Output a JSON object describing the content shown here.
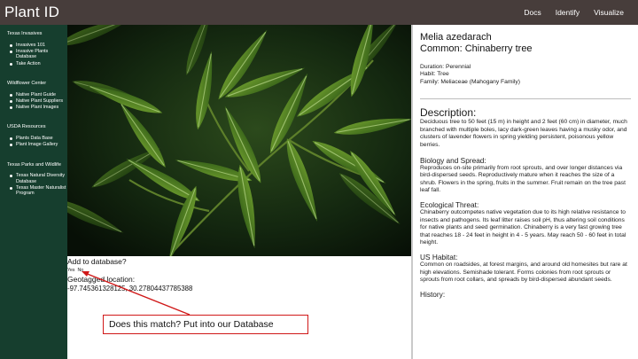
{
  "brand": "Plant ID",
  "nav": [
    "Docs",
    "Identify",
    "Visualize"
  ],
  "sidebar": {
    "sections": [
      {
        "heading": "Texas Invasives",
        "items": [
          "Invasives 101",
          "Invasive Plants Database",
          "Take Action"
        ]
      },
      {
        "heading": "Wildflower Center",
        "items": [
          "Native Plant Guide",
          "Native Plant Suppliers",
          "Native Plant Images"
        ]
      },
      {
        "heading": "USDA Resources",
        "items": [
          "Plants Data Base",
          "Plant Image Gallery"
        ]
      },
      {
        "heading": "Texas Parks and Wildlife",
        "items": [
          "Texas Natural Diversity Database",
          "Texas Master Naturalist Program"
        ]
      }
    ]
  },
  "add": {
    "title": "Add to database?",
    "yes": "Yes",
    "no": "No",
    "geo_title": "Geotagged location:",
    "geo_value": "-97.745361328125, 30.27804437785388"
  },
  "callout": "Does this match? Put into our Database",
  "plant": {
    "scientific": "Melia azedarach",
    "common": "Common: Chinaberry tree",
    "duration": "Duration: Perennial",
    "habit": "Habit: Tree",
    "family": "Family: Meliaceae (Mahogany Family)",
    "description_heading": "Description:",
    "description": "Deciduous tree to 50 feet (15 m) in height and 2 feet (60 cm) in diameter, much branched with multiple boles, lacy dark-green leaves having a musky odor, and clusters of lavender flowers in spring yielding persistent, poisonous yellow berries.",
    "biology_heading": "Biology and Spread:",
    "biology": "Reproduces on-site primarily from root sprouts, and over longer distances via bird-dispersed seeds. Reproductively mature when it reaches the size of a shrub. Flowers in the spring, fruits in the summer. Fruit remain on the tree past leaf fall.",
    "threat_heading": "Ecological Threat:",
    "threat": "Chinaberry outcompetes native vegetation due to its high relative resistance to insects and pathogens. Its leaf litter raises soil pH, thus altering soil conditions for native plants and seed germination. Chinaberry is a very fast growing tree that reaches 18 - 24 feet in height in 4 - 5 years. May reach 50 - 60 feet in total height.",
    "habitat_heading": "US Habitat:",
    "habitat": "Common on roadsides, at forest margins, and around old homesites but rare at high elevations. Semishade tolerant. Forms colonies from root sprouts or sprouts from root collars, and spreads by bird-dispersed abundant seeds.",
    "history_heading": "History:"
  },
  "colors": {
    "topbar": "#473d3b",
    "sidebar": "#163e2e",
    "annotation": "#d01818"
  }
}
